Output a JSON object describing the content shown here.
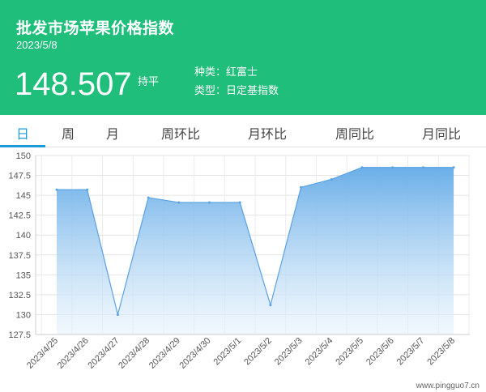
{
  "header": {
    "title": "批发市场苹果价格指数",
    "date": "2023/5/8",
    "price": "148.507",
    "trend": "持平",
    "variety": "种类：红富士",
    "type": "类型：日定基指数"
  },
  "tabs": [
    {
      "label": "日",
      "active": true
    },
    {
      "label": "周",
      "active": false
    },
    {
      "label": "月",
      "active": false
    },
    {
      "label": "周环比",
      "active": false
    },
    {
      "label": "月环比",
      "active": false
    },
    {
      "label": "周同比",
      "active": false
    },
    {
      "label": "月同比",
      "active": false
    }
  ],
  "colors": {
    "header_bg": "#1fbf7b",
    "active_tab": "#1a9bd7",
    "area_top": "#6aaee8",
    "line": "#5aa2e2"
  },
  "watermark": "www.pingguo7.cn",
  "chart_data": {
    "type": "area",
    "categories": [
      "2023/4/25",
      "2023/4/26",
      "2023/4/27",
      "2023/4/28",
      "2023/4/29",
      "2023/4/30",
      "2023/5/1",
      "2023/5/2",
      "2023/5/3",
      "2023/5/4",
      "2023/5/5",
      "2023/5/6",
      "2023/5/7",
      "2023/5/8"
    ],
    "values": [
      145.7,
      145.7,
      130.0,
      144.7,
      144.1,
      144.1,
      144.1,
      131.2,
      146.0,
      147.0,
      148.5,
      148.5,
      148.5,
      148.5
    ],
    "ylim": [
      127.5,
      150
    ],
    "yticks": [
      "127.5",
      "130",
      "132.5",
      "135",
      "137.5",
      "140",
      "142.5",
      "145",
      "147.5",
      "150"
    ],
    "grid": true
  }
}
